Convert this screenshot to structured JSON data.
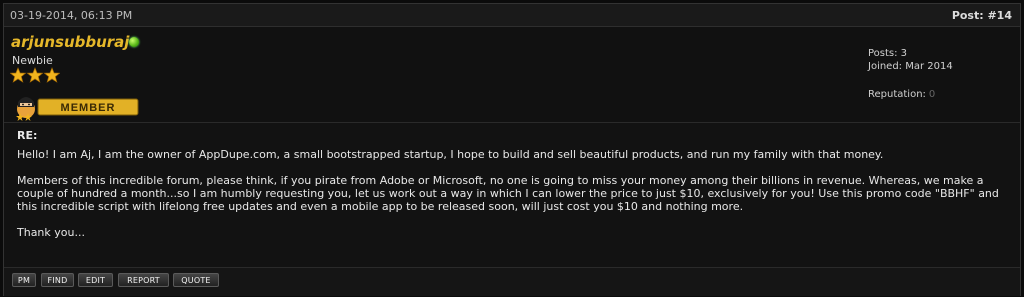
{
  "header": {
    "date": "03-19-2014, 06:13 PM",
    "post_number": "Post: #14"
  },
  "user": {
    "name": "arjunsubburaj",
    "title": "Newbie",
    "stars": 3,
    "rank_badge_text": "MEMBER",
    "online_color": "#52b315"
  },
  "stats": {
    "posts": "Posts: 3",
    "joined": "Joined: Mar 2014",
    "reputation_label": "Reputation:",
    "reputation_value": "0"
  },
  "message": {
    "subject": "RE:",
    "paragraphs": [
      "Hello! I am Aj, I am the owner of AppDupe.com, a small bootstrapped startup, I hope to build and sell beautiful products, and run my family with that money.",
      "Members of this incredible forum, please think, if you pirate from Adobe or Microsoft, no one is going to miss your money among their billions in revenue. Whereas, we make a couple of hundred a month...so I am humbly requesting you, let us work out a way in which I can lower the price to just $10, exclusively for you! Use this promo code \"BBHF\" and this incredible script with lifelong free updates and even a mobile app to be released soon, will just cost you $10 and nothing more.",
      "Thank you..."
    ]
  },
  "buttons": {
    "pm": "PM",
    "find": "FIND",
    "edit": "EDIT",
    "report": "REPORT",
    "quote": "QUOTE"
  },
  "colors": {
    "username": "#e6b82a",
    "star": "#f2b51e",
    "background": "#121212"
  }
}
